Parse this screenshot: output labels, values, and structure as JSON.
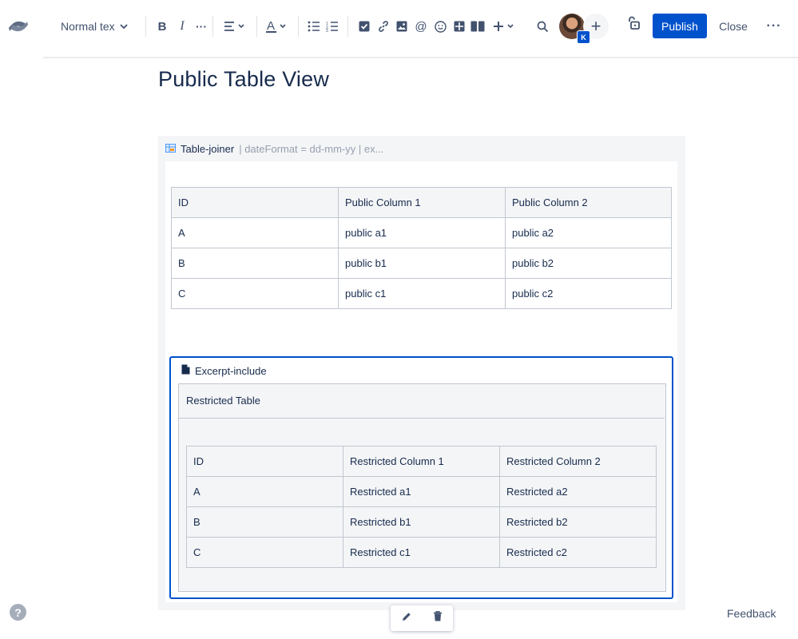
{
  "toolbar": {
    "text_style": "Normal tex",
    "publish_label": "Publish",
    "close_label": "Close",
    "avatar_badge": "K",
    "icons": [
      "confluence-logo",
      "bold",
      "italic",
      "more-formatting",
      "align",
      "text-color",
      "bullet-list",
      "numbered-list",
      "task",
      "link",
      "image",
      "mention",
      "emoji",
      "table",
      "layout",
      "insert",
      "search",
      "invite",
      "restrictions",
      "more"
    ]
  },
  "page": {
    "title": "Public Table View"
  },
  "macro": {
    "name": "Table-joiner",
    "params": " | dateFormat = dd-mm-yy | ex..."
  },
  "public_table": {
    "rows": [
      [
        "ID",
        "Public Column 1",
        "Public Column 2"
      ],
      [
        "A",
        "public a1",
        "public a2"
      ],
      [
        "B",
        "public b1",
        "public b2"
      ],
      [
        "C",
        "public c1",
        "public c2"
      ]
    ]
  },
  "excerpt": {
    "title": "Excerpt-include",
    "panel_title": "Restricted Table",
    "rows": [
      [
        "ID",
        "Restricted Column 1",
        "Restricted Column 2"
      ],
      [
        "A",
        "Restricted a1",
        "Restricted a2"
      ],
      [
        "B",
        "Restricted b1",
        "Restricted b2"
      ],
      [
        "C",
        "Restricted c1",
        "Restricted c2"
      ]
    ]
  },
  "footer": {
    "help": "?",
    "feedback": "Feedback"
  },
  "colors": {
    "accent": "#0052cc",
    "text": "#172b4d",
    "muted": "#97a0af",
    "border": "#c1c7d0"
  }
}
